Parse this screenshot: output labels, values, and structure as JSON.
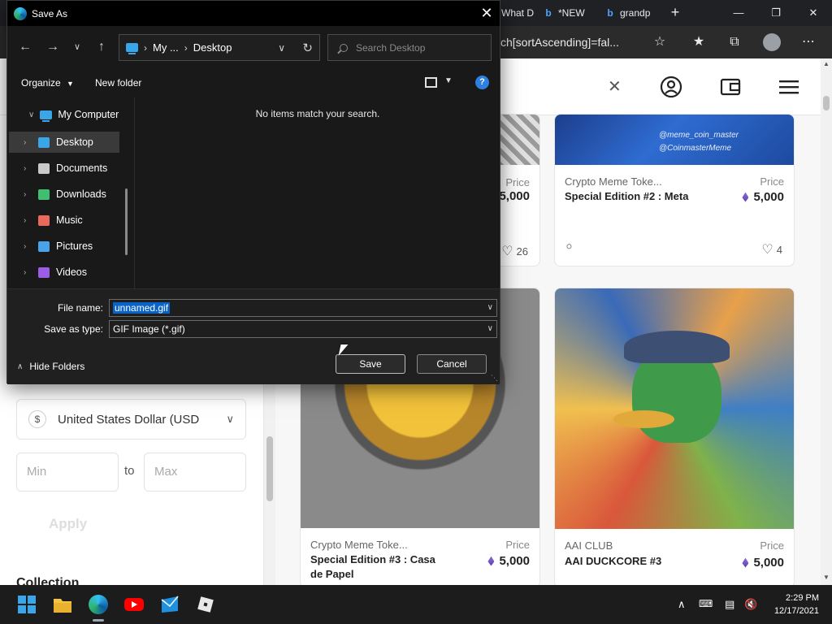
{
  "browser": {
    "tabs": [
      {
        "label": "What D",
        "icon": "page-icon"
      },
      {
        "label": "*NEW",
        "icon": "bing-icon"
      },
      {
        "label": "grandp",
        "icon": "bing-icon"
      }
    ],
    "address_fragment": "ch[sortAscending]=fal..."
  },
  "dialog": {
    "title": "Save As",
    "breadcrumb": [
      "My ...",
      "Desktop"
    ],
    "search_placeholder": "Search Desktop",
    "organize_label": "Organize",
    "new_folder_label": "New folder",
    "help_label": "?",
    "nav_root": "My Computer",
    "nav_items": [
      {
        "label": "Desktop",
        "icon": "desktop-icon",
        "color": "#3aa6e8",
        "selected": true
      },
      {
        "label": "Documents",
        "icon": "documents-icon",
        "color": "#c9c9c9",
        "selected": false
      },
      {
        "label": "Downloads",
        "icon": "downloads-icon",
        "color": "#3fbf6f",
        "selected": false
      },
      {
        "label": "Music",
        "icon": "music-icon",
        "color": "#e86a5c",
        "selected": false
      },
      {
        "label": "Pictures",
        "icon": "pictures-icon",
        "color": "#4aa3e8",
        "selected": false
      },
      {
        "label": "Videos",
        "icon": "videos-icon",
        "color": "#9b5de5",
        "selected": false
      }
    ],
    "empty_message": "No items match your search.",
    "file_name_label": "File name:",
    "file_name_value": "unnamed.gif",
    "save_type_label": "Save as type:",
    "save_type_value": "GIF Image (*.gif)",
    "hide_folders_label": "Hide Folders",
    "save_button": "Save",
    "cancel_button": "Cancel"
  },
  "filters": {
    "currency": "United States Dollar (USD",
    "currency_symbol": "$",
    "min_placeholder": "Min",
    "max_placeholder": "Max",
    "to_label": "to",
    "apply_label": "Apply",
    "collections_label": "Collection"
  },
  "cards": [
    {
      "collection": "",
      "price_label": "Price",
      "title": "",
      "price": "5,000",
      "likes": "26"
    },
    {
      "collection": "Crypto Meme Toke...",
      "price_label": "Price",
      "title": "Special Edition #2 : Meta",
      "price": "5,000",
      "likes": "4"
    },
    {
      "collection": "Crypto Meme Toke...",
      "price_label": "Price",
      "title": "Special Edition #3 : Casa de Papel",
      "price": "5,000",
      "likes": ""
    },
    {
      "collection": "AAI CLUB",
      "price_label": "Price",
      "title": "AAI DUCKCORE #3",
      "price": "5,000",
      "likes": ""
    }
  ],
  "meme_card_text": [
    "@meme_coin_master",
    "@CoinmasterMeme"
  ],
  "taskbar": {
    "apps": [
      "start-icon",
      "file-explorer-icon",
      "edge-icon",
      "youtube-icon",
      "mail-icon",
      "roblox-icon"
    ],
    "time": "2:29 PM",
    "date": "12/17/2021"
  }
}
